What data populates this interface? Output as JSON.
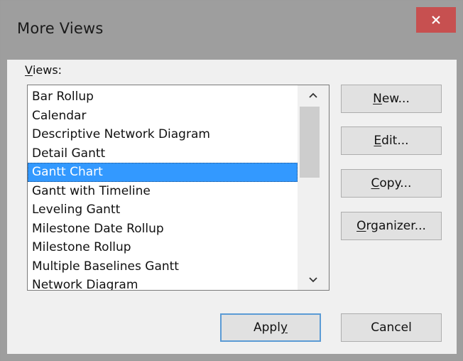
{
  "window": {
    "title": "More Views",
    "close_icon": "close-icon"
  },
  "views": {
    "label_mnemonic": "V",
    "label_rest": "iews:",
    "items": [
      "Bar Rollup",
      "Calendar",
      "Descriptive Network Diagram",
      "Detail Gantt",
      "Gantt Chart",
      "Gantt with Timeline",
      "Leveling Gantt",
      "Milestone Date Rollup",
      "Milestone Rollup",
      "Multiple Baselines Gantt",
      "Network Diagram"
    ],
    "selected": "Gantt Chart"
  },
  "buttons": {
    "new": {
      "mnemonic": "N",
      "rest": "ew..."
    },
    "edit": {
      "mnemonic": "E",
      "rest": "dit..."
    },
    "copy": {
      "mnemonic": "C",
      "rest": "opy..."
    },
    "organizer": {
      "mnemonic": "O",
      "rest": "rganizer..."
    },
    "apply": {
      "pre": "Appl",
      "mnemonic": "y"
    },
    "cancel": {
      "label": "Cancel"
    }
  },
  "colors": {
    "selection": "#3399ff",
    "close_button": "#c75050",
    "title_bar": "#9e9e9e"
  }
}
